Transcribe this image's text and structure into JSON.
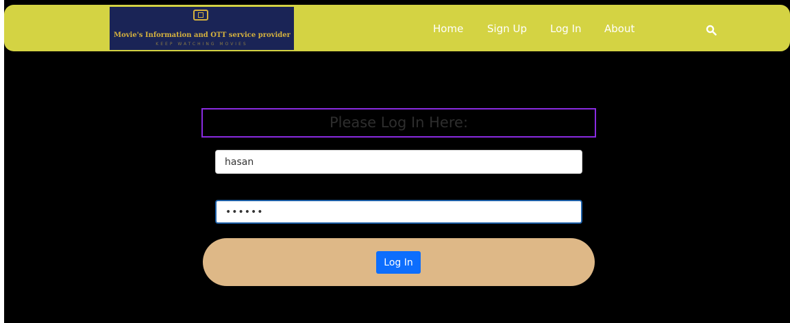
{
  "brand": {
    "title": "Movie's Information and OTT service provider",
    "tagline": "KEEP WATCHING MOVIES",
    "icon": "tv-icon"
  },
  "nav": {
    "links": [
      {
        "label": "Home"
      },
      {
        "label": "Sign Up"
      },
      {
        "label": "Log In"
      },
      {
        "label": "About"
      }
    ],
    "search_icon": "search-icon"
  },
  "login": {
    "title": "Please Log In Here:",
    "username_value": "hasan",
    "password_value": "••••••",
    "button_label": "Log In"
  },
  "colors": {
    "navbar_bg": "#d4d343",
    "page_bg": "#000000",
    "title_border": "#8a2be2",
    "button_panel_bg": "#deb887",
    "button_bg": "#0d6efd",
    "logo_bg": "#1a2456",
    "logo_text": "#d6b23e"
  }
}
